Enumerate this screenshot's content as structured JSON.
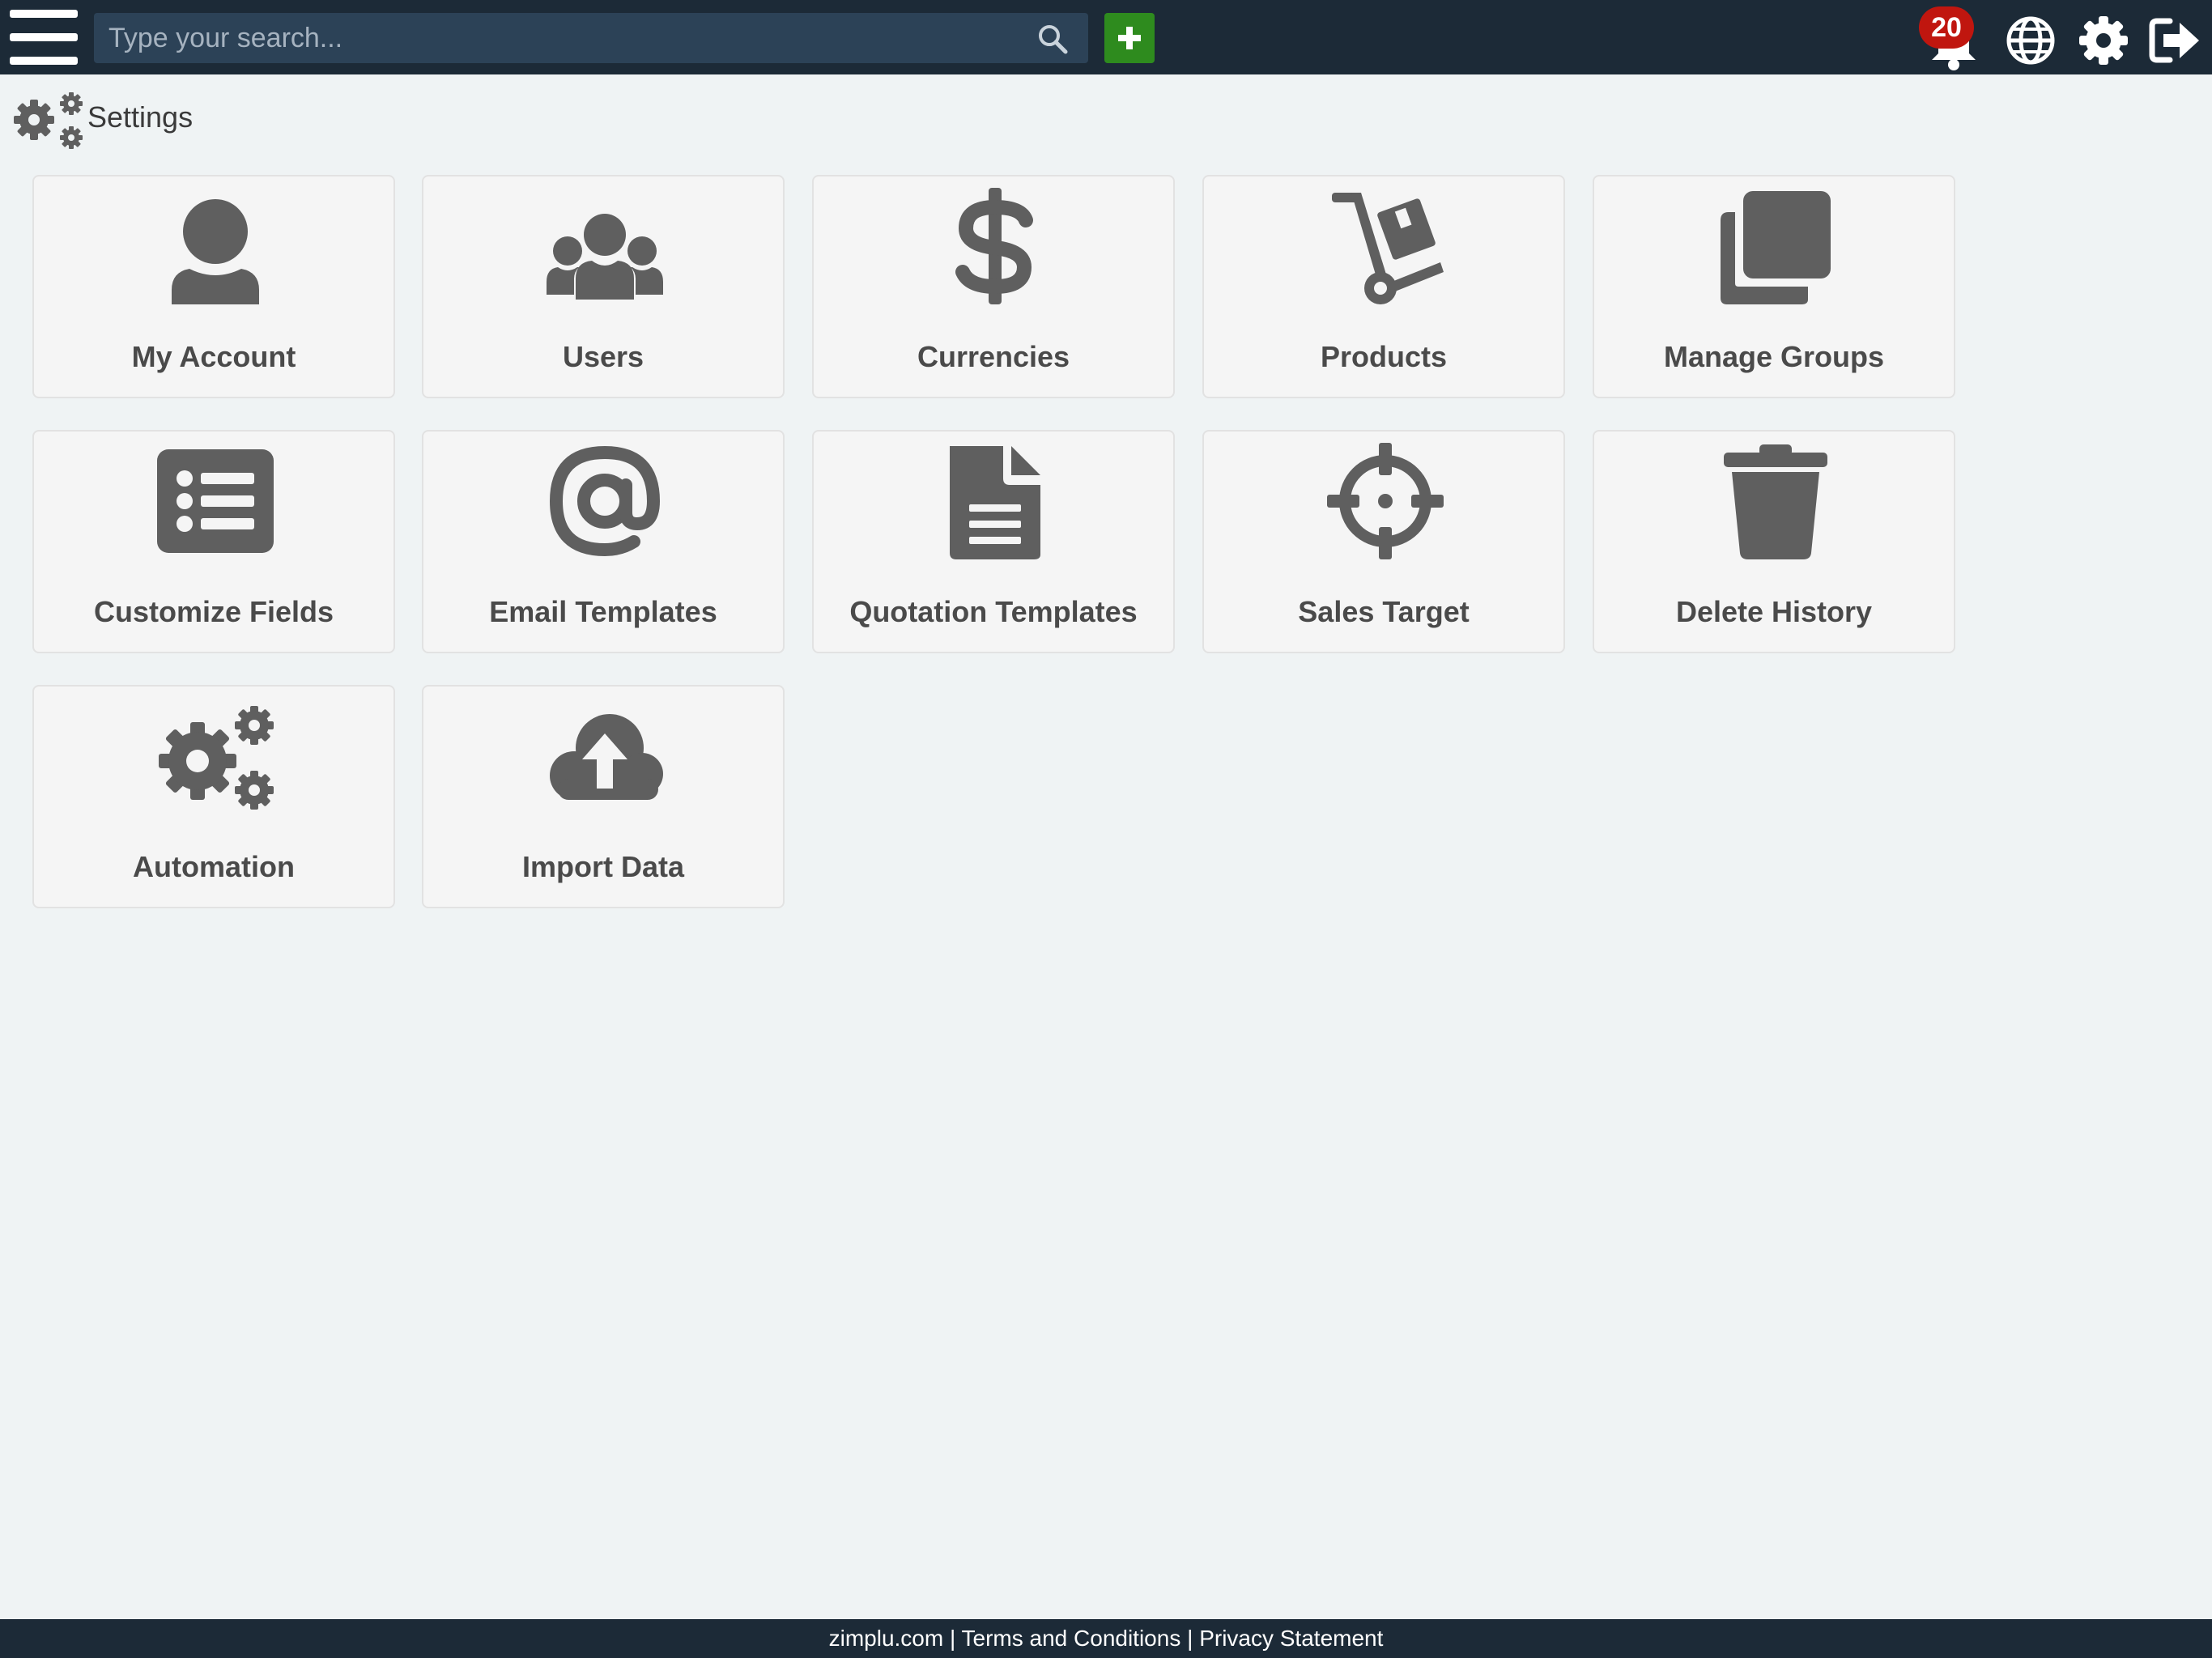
{
  "header": {
    "search_placeholder": "Type your search...",
    "notification_count": "20"
  },
  "breadcrumb": {
    "label": "Settings"
  },
  "tiles": [
    {
      "label": "My Account",
      "icon": "user-icon"
    },
    {
      "label": "Users",
      "icon": "users-icon"
    },
    {
      "label": "Currencies",
      "icon": "dollar-icon"
    },
    {
      "label": "Products",
      "icon": "dolly-icon"
    },
    {
      "label": "Manage Groups",
      "icon": "clone-icon"
    },
    {
      "label": "Customize Fields",
      "icon": "list-icon"
    },
    {
      "label": "Email Templates",
      "icon": "at-icon"
    },
    {
      "label": "Quotation Templates",
      "icon": "document-icon"
    },
    {
      "label": "Sales Target",
      "icon": "crosshairs-icon"
    },
    {
      "label": "Delete History",
      "icon": "trash-icon"
    },
    {
      "label": "Automation",
      "icon": "cogs-icon"
    },
    {
      "label": "Import Data",
      "icon": "cloud-upload-icon"
    }
  ],
  "footer": {
    "site": "zimplu.com",
    "separator": " | ",
    "terms": "Terms and Conditions",
    "privacy": "Privacy Statement"
  },
  "colors": {
    "topbar": "#1c2a37",
    "search_bg": "#2c4257",
    "add_button": "#2e8b1e",
    "badge": "#c0160f",
    "icon_gray": "#5f5f5f",
    "page_bg": "#eff3f4"
  }
}
